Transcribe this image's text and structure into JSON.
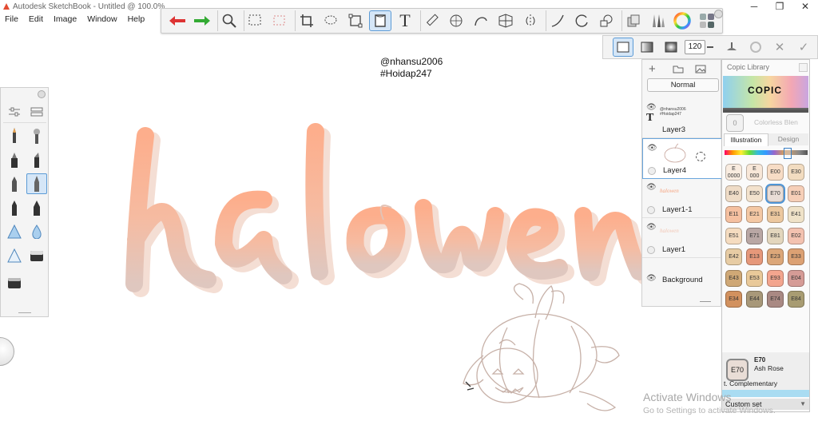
{
  "app": {
    "title": "Autodesk SketchBook - Untitled @ 100.0%"
  },
  "window_controls": {
    "minimize": "─",
    "maximize": "❐",
    "close": "✕"
  },
  "menu": [
    "File",
    "Edit",
    "Image",
    "Window",
    "Help"
  ],
  "toolbar": {
    "tools": [
      "undo-icon",
      "redo-icon",
      "zoom-icon",
      "select-rect-icon",
      "select-dotted-icon",
      "crop-icon",
      "lasso-icon",
      "transform-icon",
      "fill-icon",
      "text-icon",
      "ruler-icon",
      "ellipse-guide-icon",
      "curve-ruler-icon",
      "perspective-icon",
      "symmetry-icon",
      "stroke-icon",
      "circle-icon",
      "shapes-icon",
      "layer-editor-icon",
      "brush-library-icon",
      "color-wheel-icon",
      "copic-icon"
    ],
    "selected": "fill-icon",
    "text_tool_glyph": "T"
  },
  "brushbar": {
    "size_value": "120"
  },
  "watermark": {
    "line1": "@nhansu2006",
    "line2": "#Hoidap247"
  },
  "layers": {
    "blend_mode": "Normal",
    "items": [
      {
        "name": "Layer3",
        "thumb_text": "@nhansu2006 #Hoidap247"
      },
      {
        "name": "Layer4"
      },
      {
        "name": "Layer1-1",
        "thumb_text": "halowen"
      },
      {
        "name": "Layer1",
        "thumb_text": "halowen"
      },
      {
        "name": "Background"
      }
    ]
  },
  "copic": {
    "title": "Copic Library",
    "logo": "COPIC",
    "colorless_blender": "Colorless Blen",
    "colorless_code": "0",
    "tabs": [
      "Illustration",
      "Design"
    ],
    "active_tab": "Illustration",
    "swatches": [
      {
        "code": "E\n0000",
        "color": "#f9ece0"
      },
      {
        "code": "E\n000",
        "color": "#f8e7d8"
      },
      {
        "code": "E00",
        "color": "#f7dcc5"
      },
      {
        "code": "E30",
        "color": "#f2dcc0"
      },
      {
        "code": "E40",
        "color": "#efdcc7"
      },
      {
        "code": "E50",
        "color": "#f3e2cd"
      },
      {
        "code": "E70",
        "color": "#e9ddd6"
      },
      {
        "code": "E01",
        "color": "#f6cfb8"
      },
      {
        "code": "E11",
        "color": "#f5c0a0"
      },
      {
        "code": "E21",
        "color": "#f4c8a4"
      },
      {
        "code": "E31",
        "color": "#ecc89f"
      },
      {
        "code": "E41",
        "color": "#efe2c8"
      },
      {
        "code": "E51",
        "color": "#f5dcc0"
      },
      {
        "code": "E71",
        "color": "#b9a7a4"
      },
      {
        "code": "E81",
        "color": "#e3d6bd"
      },
      {
        "code": "E02",
        "color": "#f3c2b0"
      },
      {
        "code": "E42",
        "color": "#e7cca4"
      },
      {
        "code": "E13",
        "color": "#e6987a"
      },
      {
        "code": "E23",
        "color": "#dca779"
      },
      {
        "code": "E33",
        "color": "#dca173"
      },
      {
        "code": "E43",
        "color": "#cfa876"
      },
      {
        "code": "E53",
        "color": "#e9c999"
      },
      {
        "code": "E93",
        "color": "#f3a58e"
      },
      {
        "code": "E04",
        "color": "#d59b96"
      },
      {
        "code": "E34",
        "color": "#d2915e"
      },
      {
        "code": "E44",
        "color": "#a89879"
      },
      {
        "code": "E74",
        "color": "#a98983"
      },
      {
        "code": "E84",
        "color": "#a89c72"
      }
    ],
    "selected": {
      "code": "E70",
      "name": "Ash Rose",
      "color": "#e9ddd6"
    },
    "complementary": "t. Complementary",
    "custom_set": "Custom set"
  },
  "activation": {
    "line1": "Activate Windows",
    "line2": "Go to Settings to activate Windows."
  },
  "colors": {
    "accent": "#5c9bd6",
    "lettering_top": "#fbb08f",
    "lettering_bottom": "#e2cac0",
    "shadow": "#f3ded4"
  }
}
